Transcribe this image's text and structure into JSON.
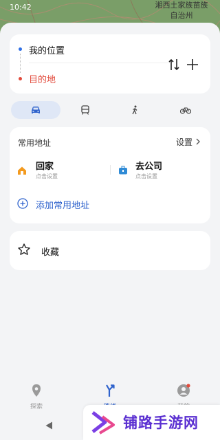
{
  "status_bar": {
    "time": "10:42"
  },
  "map": {
    "label_line1": "湘西土家族苗族",
    "label_line2": "自治州"
  },
  "route": {
    "from": "我的位置",
    "to": "目的地"
  },
  "modes": [
    "car",
    "train",
    "walk",
    "bike"
  ],
  "favorites": {
    "title": "常用地址",
    "settings": "设置",
    "home": {
      "name": "回家",
      "sub": "点击设置"
    },
    "work": {
      "name": "去公司",
      "sub": "点击设置"
    },
    "add_label": "添加常用地址"
  },
  "collect": {
    "label": "收藏"
  },
  "nav": {
    "explore": "探索",
    "route": "路线",
    "me": "我的"
  },
  "ad": {
    "text": "铺路手游网"
  },
  "colors": {
    "accent": "#2e62cc",
    "red": "#e24a3b",
    "active_mode_bg": "#dfe7f6"
  }
}
